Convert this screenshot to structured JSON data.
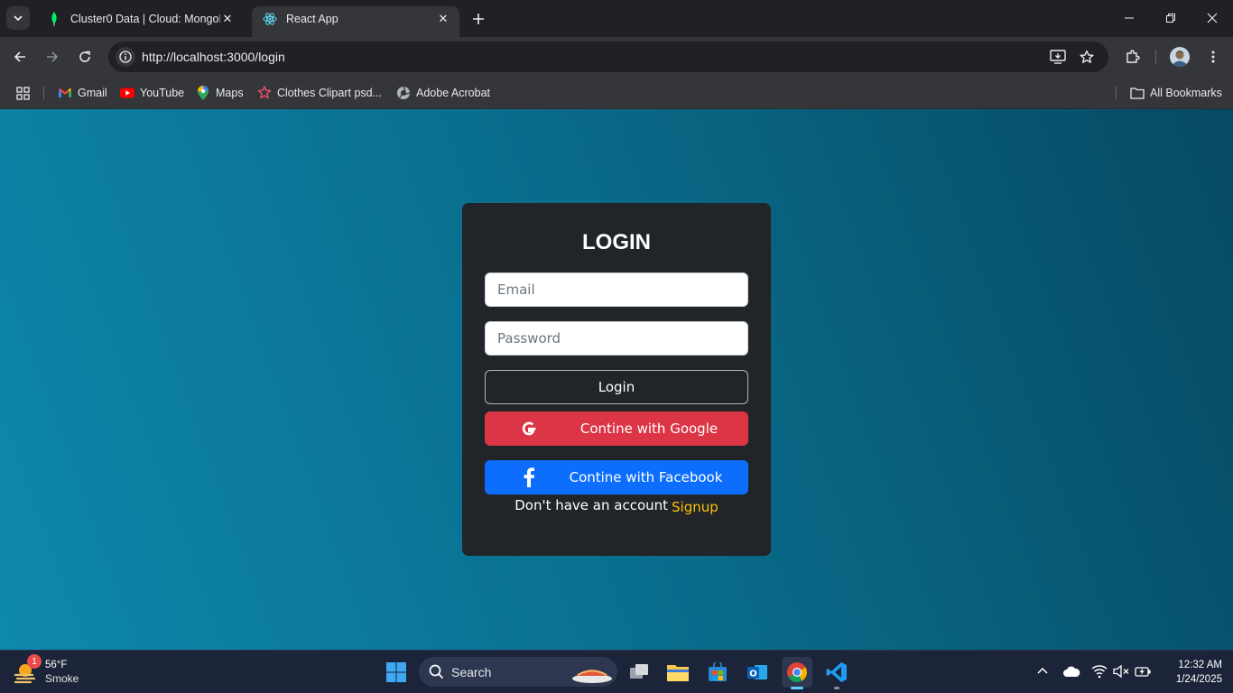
{
  "browser": {
    "tabs": [
      {
        "title": "Cluster0 Data | Cloud: MongoDB",
        "active": false,
        "icon": "mongodb-leaf-icon"
      },
      {
        "title": "React App",
        "active": true,
        "icon": "react-icon"
      }
    ],
    "url": "http://localhost:3000/login",
    "bookmarks": [
      {
        "label": "Gmail",
        "icon": "gmail-icon"
      },
      {
        "label": "YouTube",
        "icon": "youtube-icon"
      },
      {
        "label": "Maps",
        "icon": "maps-icon"
      },
      {
        "label": "Clothes Clipart psd...",
        "icon": "clipart-icon"
      },
      {
        "label": "Adobe Acrobat",
        "icon": "acrobat-icon"
      }
    ],
    "all_bookmarks_label": "All Bookmarks"
  },
  "login": {
    "title": "LOGIN",
    "email_placeholder": "Email",
    "password_placeholder": "Password",
    "login_button": "Login",
    "google_button": "Contine with Google",
    "facebook_button": "Contine with Facebook",
    "no_account_text": "Don't have an account",
    "signup_link": "Signup"
  },
  "colors": {
    "card": "#212529",
    "google": "#dc3545",
    "facebook": "#0d6efd",
    "signup": "#ffc107"
  },
  "taskbar": {
    "weather_temp": "56°F",
    "weather_condition": "Smoke",
    "weather_badge": "1",
    "search_label": "Search",
    "time": "12:32 AM",
    "date": "1/24/2025"
  }
}
